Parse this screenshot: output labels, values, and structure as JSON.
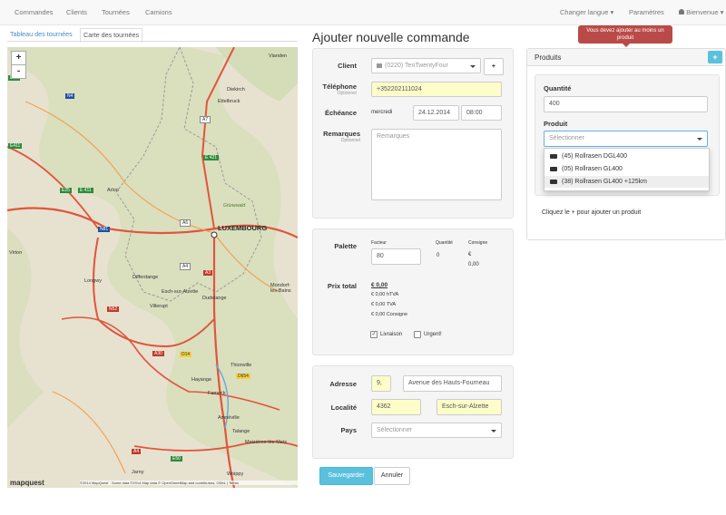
{
  "navbar": {
    "items": [
      "Commandes",
      "Clients",
      "Tournées",
      "Camions"
    ],
    "language": "Changer langue",
    "settings": "Paramètres",
    "welcome": "Bienvenue"
  },
  "tabs": {
    "table": "Tableau des tournées",
    "map": "Carte des tournées"
  },
  "map": {
    "zoom_in": "+",
    "zoom_out": "-",
    "logo": "mapquest",
    "attribution": "©2014 MapQuest · Some data ©2014 Map data © OpenStreetMap and contributors, ODbL | Terms",
    "places": [
      {
        "name": "LUXEMBOURG",
        "cls": "big"
      },
      {
        "name": "Arlon"
      },
      {
        "name": "Diekirch"
      },
      {
        "name": "Ettelbruck"
      },
      {
        "name": "Vianden"
      },
      {
        "name": "Longwy"
      },
      {
        "name": "Differdange"
      },
      {
        "name": "Esch-sur-Alzette"
      },
      {
        "name": "Dudelange"
      },
      {
        "name": "Villerupt"
      },
      {
        "name": "Thionville"
      },
      {
        "name": "Hayange"
      },
      {
        "name": "Fameck"
      },
      {
        "name": "Amnéville"
      },
      {
        "name": "Talange"
      },
      {
        "name": "Maizières-lès-Metz"
      },
      {
        "name": "Jarny"
      },
      {
        "name": "Woippy"
      },
      {
        "name": "Virton"
      },
      {
        "name": "Mondorf-les-Bains"
      },
      {
        "name": "Grünewald"
      }
    ],
    "shields": [
      "E25",
      "N4",
      "E411",
      "E25",
      "E 411",
      "A7",
      "E 421",
      "N81",
      "A6",
      "A4",
      "A3",
      "N52",
      "A30",
      "D14",
      "D654",
      "A4",
      "E50"
    ]
  },
  "form": {
    "title": "Ajouter nouvelle commande",
    "client_label": "Client",
    "client_value": "(0220) TenTwentyFour",
    "client_add": "+",
    "phone_label": "Téléphone",
    "optional": "Optionnel",
    "phone_value": "+352202111024",
    "due_label": "Échéance",
    "due_day": "mercredi",
    "due_date": "24.12.2014",
    "due_time": "08:00",
    "remarks_label": "Remarques",
    "remarks_placeholder": "Remarques",
    "pallet_label": "Palette",
    "col_factor": "Facteur",
    "col_quantity": "Quantité",
    "col_deposit": "Consigne",
    "factor_value": "80",
    "quantity_value": "0",
    "deposit_line1": "€",
    "deposit_line2": "0,00",
    "total_label": "Prix total",
    "total_value": "€ 0,00",
    "total_htva": "€ 0,00 hTVA",
    "total_tva": "€ 0,00 TVA",
    "total_deposit": "€ 0,00 Consigne",
    "delivery_label": "Livraison",
    "delivery_checked": true,
    "urgent_label": "Urgent!",
    "urgent_checked": false,
    "address_label": "Adresse",
    "address_number": "9,",
    "address_street": "Avenue des Hauts-Fourneau",
    "locality_label": "Localité",
    "postal_code": "4362",
    "city": "Esch-sur-Alzette",
    "country_label": "Pays",
    "country_placeholder": "Sélectionner",
    "save": "Sauvegarder",
    "cancel": "Annuler"
  },
  "products": {
    "title": "Produits",
    "add": "+",
    "tooltip": "Vous devez ajouter au moins un produit",
    "quantity_label": "Quantité",
    "quantity_value": "400",
    "product_label": "Produit",
    "product_placeholder": "Sélectionner",
    "options": [
      "(45) Rollrasen DGL400",
      "(05) Rollrasen GL400",
      "(38) Rollrasen GL400 +125km"
    ],
    "hint": "Cliquez le + pour ajouter un produit"
  },
  "colors": {
    "accent": "#428bca",
    "save": "#5bc0de",
    "tooltip": "#b94a48",
    "highlight_field": "#fdfdc9"
  }
}
